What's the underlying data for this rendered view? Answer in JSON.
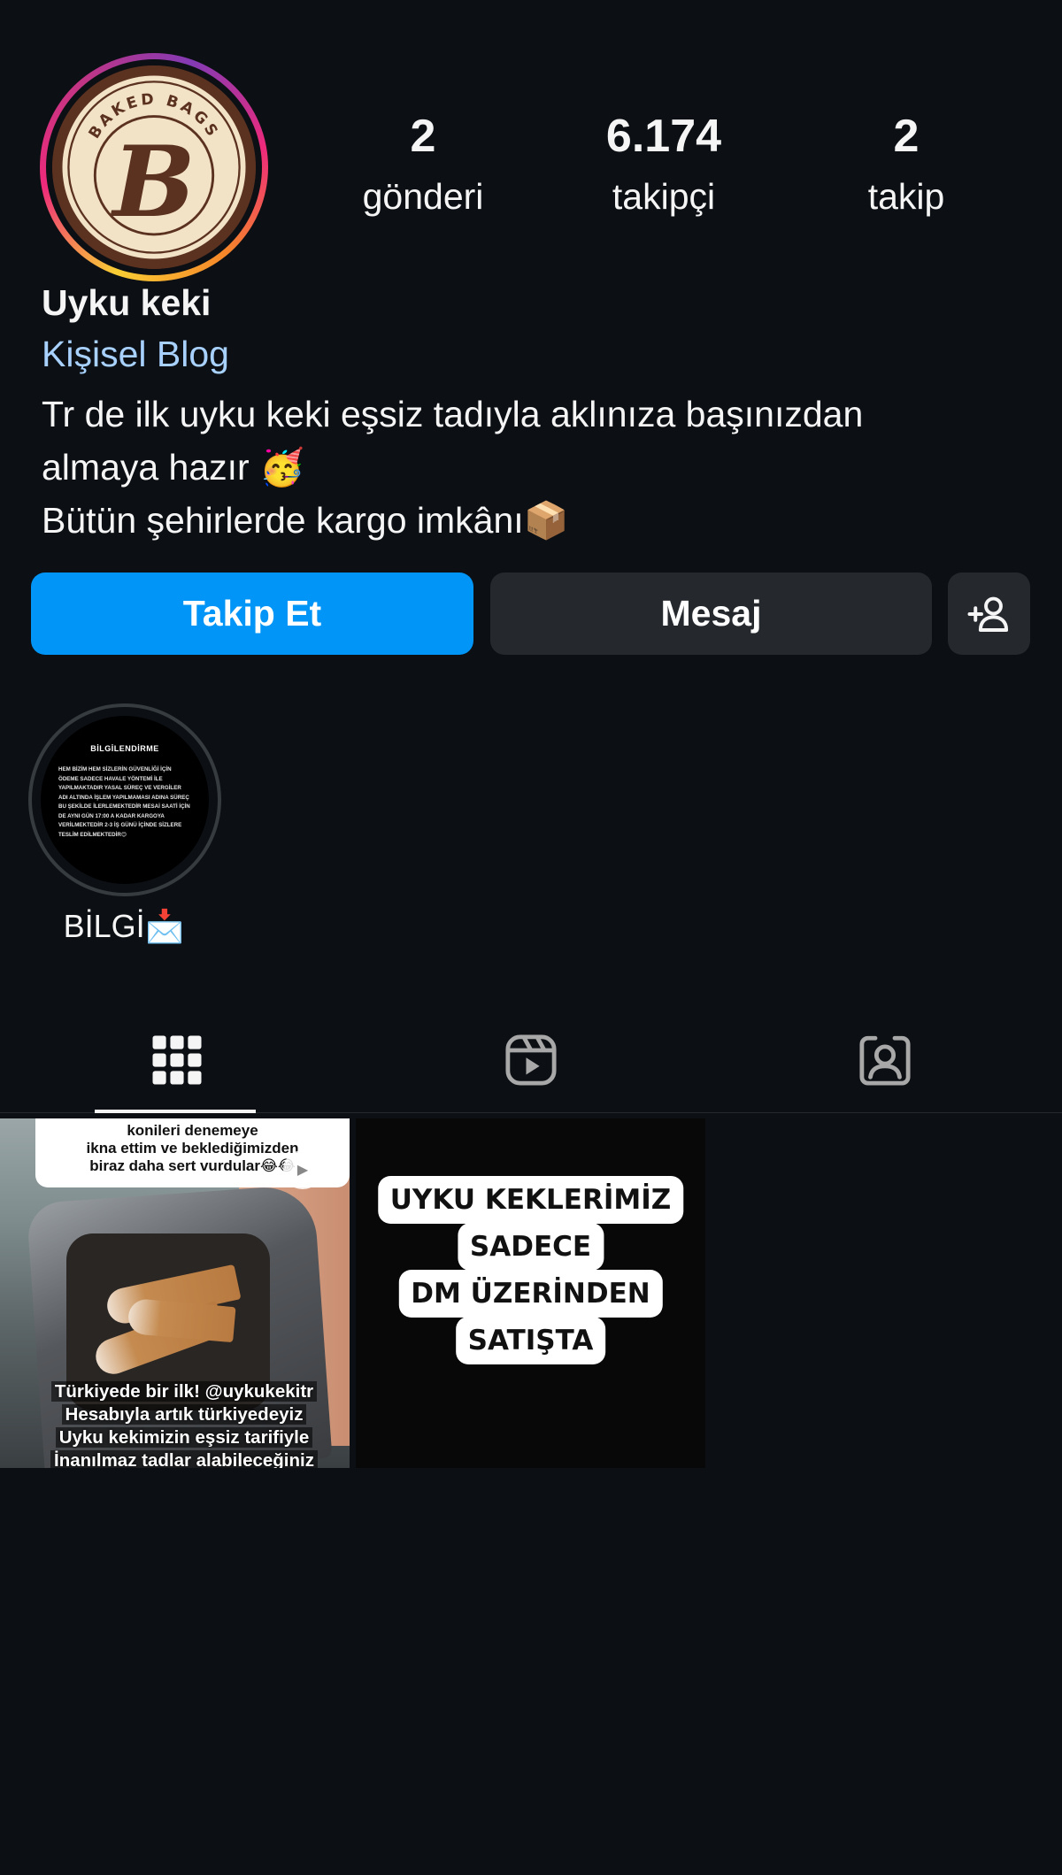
{
  "profile": {
    "avatar_text": "BAKED BAGS",
    "avatar_letter": "B",
    "name": "Uyku keki",
    "category": "Kişisel Blog",
    "bio_lines": [
      "Tr de ilk uyku keki eşsiz tadıyla aklınıza başınızdan",
      "almaya hazır 🥳",
      "Bütün şehirlerde kargo imkânı📦"
    ]
  },
  "stats": {
    "posts": {
      "value": "2",
      "label": "gönderi"
    },
    "followers": {
      "value": "6.174",
      "label": "takipçi"
    },
    "following": {
      "value": "2",
      "label": "takip"
    }
  },
  "actions": {
    "follow_label": "Takip Et",
    "message_label": "Mesaj",
    "add_icon": "add-person-icon"
  },
  "highlights": [
    {
      "label": "BİLGİ📩",
      "cover_title": "BİLGİLENDİRME",
      "cover_text": "HEM BİZİM HEM SİZLERİN GÜVENLİĞİ İÇİN ÖDEME SADECE HAVALE YÖNTEMİ İLE YAPILMAKTADIR YASAL SÜREÇ VE VERGİLER ADI ALTINDA İŞLEM YAPILMAMASI ADINA SÜREÇ BU ŞEKİLDE İLERLEMEKTEDİR MESAİ SAATİ İÇİN DE AYNI GÜN 17:00 A KADAR KARGOYA VERİLMEKTEDİR 2-3 İŞ GÜNÜ İÇİNDE SİZLERE TESLİM EDİLMEKTEDİR😊"
    }
  ],
  "tabs": [
    {
      "icon": "grid-icon",
      "active": true
    },
    {
      "icon": "reels-icon",
      "active": false
    },
    {
      "icon": "tagged-icon",
      "active": false
    }
  ],
  "posts": [
    {
      "top_text": [
        "konileri denemeye",
        "ikna ettim ve beklediğimizden",
        "biraz daha sert vurdular😂😂"
      ],
      "caption_lines": [
        "Türkiyede bir ilk! @uykukekitr",
        "Hesabıyla artık türkiyedeyiz",
        "Uyku kekimizin eşsiz tarifiyle",
        "İnanılmaz tadlar alabileceğiniz"
      ],
      "mention": "@uykukekitr"
    },
    {
      "lines": [
        "UYKU KEKLERİMİZ",
        "SADECE",
        "DM ÜZERİNDEN",
        "SATIŞTA"
      ]
    }
  ],
  "colors": {
    "background": "#0c1014",
    "follow_button": "#0095f6",
    "secondary_button": "#25292e",
    "link": "#a8d1ff"
  }
}
